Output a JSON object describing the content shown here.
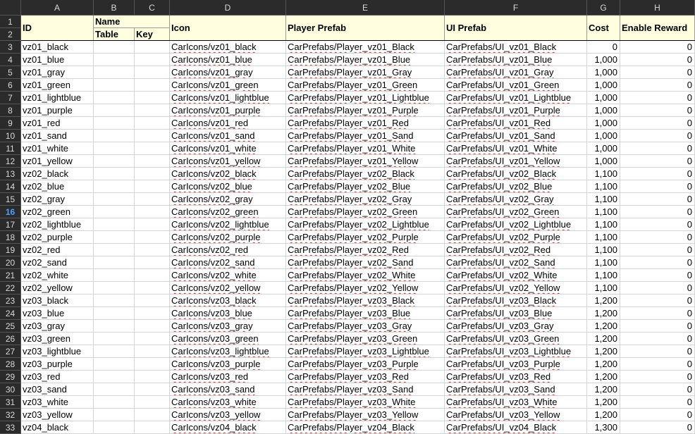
{
  "column_letters": [
    "A",
    "B",
    "C",
    "D",
    "E",
    "F",
    "G",
    "H"
  ],
  "header": {
    "id": "ID",
    "name": "Name",
    "table": "Table",
    "key": "Key",
    "icon": "Icon",
    "player_prefab": "Player Prefab",
    "ui_prefab": "UI Prefab",
    "cost": "Cost",
    "enable_reward": "Enable Reward"
  },
  "header_row_numbers": [
    "1",
    "2"
  ],
  "active_row": "16",
  "rows": [
    {
      "n": "3",
      "id": "vz01_black",
      "icon": "CarIcons/vz01_black",
      "player": "CarPrefabs/Player_vz01_Black",
      "ui": "CarPrefabs/UI_vz01_Black",
      "cost": "0",
      "reward": "0"
    },
    {
      "n": "4",
      "id": "vz01_blue",
      "icon": "CarIcons/vz01_blue",
      "player": "CarPrefabs/Player_vz01_Blue",
      "ui": "CarPrefabs/UI_vz01_Blue",
      "cost": "1,000",
      "reward": "0"
    },
    {
      "n": "5",
      "id": "vz01_gray",
      "icon": "CarIcons/vz01_gray",
      "player": "CarPrefabs/Player_vz01_Gray",
      "ui": "CarPrefabs/UI_vz01_Gray",
      "cost": "1,000",
      "reward": "0"
    },
    {
      "n": "6",
      "id": "vz01_green",
      "icon": "CarIcons/vz01_green",
      "player": "CarPrefabs/Player_vz01_Green",
      "ui": "CarPrefabs/UI_vz01_Green",
      "cost": "1,000",
      "reward": "0"
    },
    {
      "n": "7",
      "id": "vz01_lightblue",
      "icon": "CarIcons/vz01_lightblue",
      "player": "CarPrefabs/Player_vz01_Lightblue",
      "ui": "CarPrefabs/UI_vz01_Lightblue",
      "cost": "1,000",
      "reward": "0"
    },
    {
      "n": "8",
      "id": "vz01_purple",
      "icon": "CarIcons/vz01_purple",
      "player": "CarPrefabs/Player_vz01_Purple",
      "ui": "CarPrefabs/UI_vz01_Purple",
      "cost": "1,000",
      "reward": "0"
    },
    {
      "n": "9",
      "id": "vz01_red",
      "icon": "CarIcons/vz01_red",
      "player": "CarPrefabs/Player_vz01_Red",
      "ui": "CarPrefabs/UI_vz01_Red",
      "cost": "1,000",
      "reward": "0"
    },
    {
      "n": "10",
      "id": "vz01_sand",
      "icon": "CarIcons/vz01_sand",
      "player": "CarPrefabs/Player_vz01_Sand",
      "ui": "CarPrefabs/UI_vz01_Sand",
      "cost": "1,000",
      "reward": "0"
    },
    {
      "n": "11",
      "id": "vz01_white",
      "icon": "CarIcons/vz01_white",
      "player": "CarPrefabs/Player_vz01_White",
      "ui": "CarPrefabs/UI_vz01_White",
      "cost": "1,000",
      "reward": "0"
    },
    {
      "n": "12",
      "id": "vz01_yellow",
      "icon": "CarIcons/vz01_yellow",
      "player": "CarPrefabs/Player_vz01_Yellow",
      "ui": "CarPrefabs/UI_vz01_Yellow",
      "cost": "1,000",
      "reward": "0"
    },
    {
      "n": "13",
      "id": "vz02_black",
      "icon": "CarIcons/vz02_black",
      "player": "CarPrefabs/Player_vz02_Black",
      "ui": "CarPrefabs/UI_vz02_Black",
      "cost": "1,100",
      "reward": "0"
    },
    {
      "n": "14",
      "id": "vz02_blue",
      "icon": "CarIcons/vz02_blue",
      "player": "CarPrefabs/Player_vz02_Blue",
      "ui": "CarPrefabs/UI_vz02_Blue",
      "cost": "1,100",
      "reward": "0"
    },
    {
      "n": "15",
      "id": "vz02_gray",
      "icon": "CarIcons/vz02_gray",
      "player": "CarPrefabs/Player_vz02_Gray",
      "ui": "CarPrefabs/UI_vz02_Gray",
      "cost": "1,100",
      "reward": "0"
    },
    {
      "n": "16",
      "id": "vz02_green",
      "icon": "CarIcons/vz02_green",
      "player": "CarPrefabs/Player_vz02_Green",
      "ui": "CarPrefabs/UI_vz02_Green",
      "cost": "1,100",
      "reward": "0"
    },
    {
      "n": "17",
      "id": "vz02_lightblue",
      "icon": "CarIcons/vz02_lightblue",
      "player": "CarPrefabs/Player_vz02_Lightblue",
      "ui": "CarPrefabs/UI_vz02_Lightblue",
      "cost": "1,100",
      "reward": "0"
    },
    {
      "n": "18",
      "id": "vz02_purple",
      "icon": "CarIcons/vz02_purple",
      "player": "CarPrefabs/Player_vz02_Purple",
      "ui": "CarPrefabs/UI_vz02_Purple",
      "cost": "1,100",
      "reward": "0"
    },
    {
      "n": "19",
      "id": "vz02_red",
      "icon": "CarIcons/vz02_red",
      "player": "CarPrefabs/Player_vz02_Red",
      "ui": "CarPrefabs/UI_vz02_Red",
      "cost": "1,100",
      "reward": "0"
    },
    {
      "n": "20",
      "id": "vz02_sand",
      "icon": "CarIcons/vz02_sand",
      "player": "CarPrefabs/Player_vz02_Sand",
      "ui": "CarPrefabs/UI_vz02_Sand",
      "cost": "1,100",
      "reward": "0"
    },
    {
      "n": "21",
      "id": "vz02_white",
      "icon": "CarIcons/vz02_white",
      "player": "CarPrefabs/Player_vz02_White",
      "ui": "CarPrefabs/UI_vz02_White",
      "cost": "1,100",
      "reward": "0"
    },
    {
      "n": "22",
      "id": "vz02_yellow",
      "icon": "CarIcons/vz02_yellow",
      "player": "CarPrefabs/Player_vz02_Yellow",
      "ui": "CarPrefabs/UI_vz02_Yellow",
      "cost": "1,100",
      "reward": "0"
    },
    {
      "n": "23",
      "id": "vz03_black",
      "icon": "CarIcons/vz03_black",
      "player": "CarPrefabs/Player_vz03_Black",
      "ui": "CarPrefabs/UI_vz03_Black",
      "cost": "1,200",
      "reward": "0"
    },
    {
      "n": "24",
      "id": "vz03_blue",
      "icon": "CarIcons/vz03_blue",
      "player": "CarPrefabs/Player_vz03_Blue",
      "ui": "CarPrefabs/UI_vz03_Blue",
      "cost": "1,200",
      "reward": "0"
    },
    {
      "n": "25",
      "id": "vz03_gray",
      "icon": "CarIcons/vz03_gray",
      "player": "CarPrefabs/Player_vz03_Gray",
      "ui": "CarPrefabs/UI_vz03_Gray",
      "cost": "1,200",
      "reward": "0"
    },
    {
      "n": "26",
      "id": "vz03_green",
      "icon": "CarIcons/vz03_green",
      "player": "CarPrefabs/Player_vz03_Green",
      "ui": "CarPrefabs/UI_vz03_Green",
      "cost": "1,200",
      "reward": "0"
    },
    {
      "n": "27",
      "id": "vz03_lightblue",
      "icon": "CarIcons/vz03_lightblue",
      "player": "CarPrefabs/Player_vz03_Lightblue",
      "ui": "CarPrefabs/UI_vz03_Lightblue",
      "cost": "1,200",
      "reward": "0"
    },
    {
      "n": "28",
      "id": "vz03_purple",
      "icon": "CarIcons/vz03_purple",
      "player": "CarPrefabs/Player_vz03_Purple",
      "ui": "CarPrefabs/UI_vz03_Purple",
      "cost": "1,200",
      "reward": "0"
    },
    {
      "n": "29",
      "id": "vz03_red",
      "icon": "CarIcons/vz03_red",
      "player": "CarPrefabs/Player_vz03_Red",
      "ui": "CarPrefabs/UI_vz03_Red",
      "cost": "1,200",
      "reward": "0"
    },
    {
      "n": "30",
      "id": "vz03_sand",
      "icon": "CarIcons/vz03_sand",
      "player": "CarPrefabs/Player_vz03_Sand",
      "ui": "CarPrefabs/UI_vz03_Sand",
      "cost": "1,200",
      "reward": "0"
    },
    {
      "n": "31",
      "id": "vz03_white",
      "icon": "CarIcons/vz03_white",
      "player": "CarPrefabs/Player_vz03_White",
      "ui": "CarPrefabs/UI_vz03_White",
      "cost": "1,200",
      "reward": "0"
    },
    {
      "n": "32",
      "id": "vz03_yellow",
      "icon": "CarIcons/vz03_yellow",
      "player": "CarPrefabs/Player_vz03_Yellow",
      "ui": "CarPrefabs/UI_vz03_Yellow",
      "cost": "1,200",
      "reward": "0"
    },
    {
      "n": "33",
      "id": "vz04_black",
      "icon": "CarIcons/vz04_black",
      "player": "CarPrefabs/Player_vz04_Black",
      "ui": "CarPrefabs/UI_vz04_Black",
      "cost": "1,300",
      "reward": "0"
    }
  ],
  "colors": {
    "header_fill": "#ffffe0",
    "gridline": "#d4d4d4",
    "frame_bg": "#2b2b2b",
    "frame_text": "#d8d8d8",
    "active_row_text": "#4aa3ff",
    "spellcheck": "#c0392b"
  }
}
